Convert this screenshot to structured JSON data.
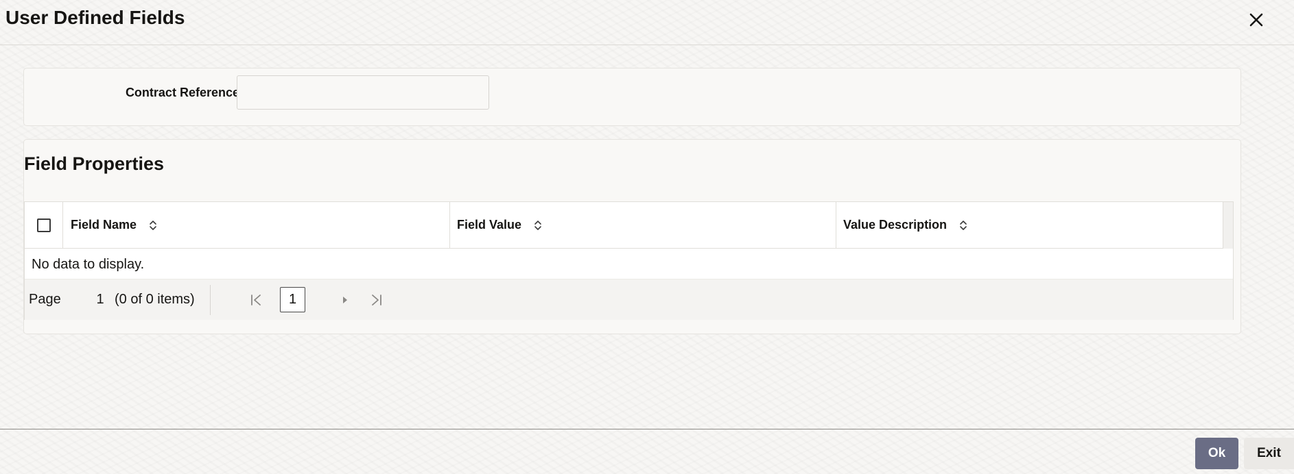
{
  "dialog": {
    "title": "User Defined Fields",
    "close_icon": "close-icon"
  },
  "contract": {
    "label": "Contract Reference",
    "value": ""
  },
  "field_properties": {
    "title": "Field Properties",
    "columns": [
      {
        "label": "Field Name",
        "icon": "sort-icon"
      },
      {
        "label": "Field Value",
        "icon": "sort-icon"
      },
      {
        "label": "Value Description",
        "icon": "sort-icon"
      }
    ],
    "rows": [],
    "empty_message": "No data to display."
  },
  "pagination": {
    "page_label": "Page",
    "page_number": "1",
    "item_count": "(0 of 0 items)",
    "current_page": "1"
  },
  "footer": {
    "ok_label": "Ok",
    "exit_label": "Exit"
  },
  "colors": {
    "ok_button": "#6a6d85",
    "exit_button": "#ebe9e6",
    "text": "#161513"
  }
}
